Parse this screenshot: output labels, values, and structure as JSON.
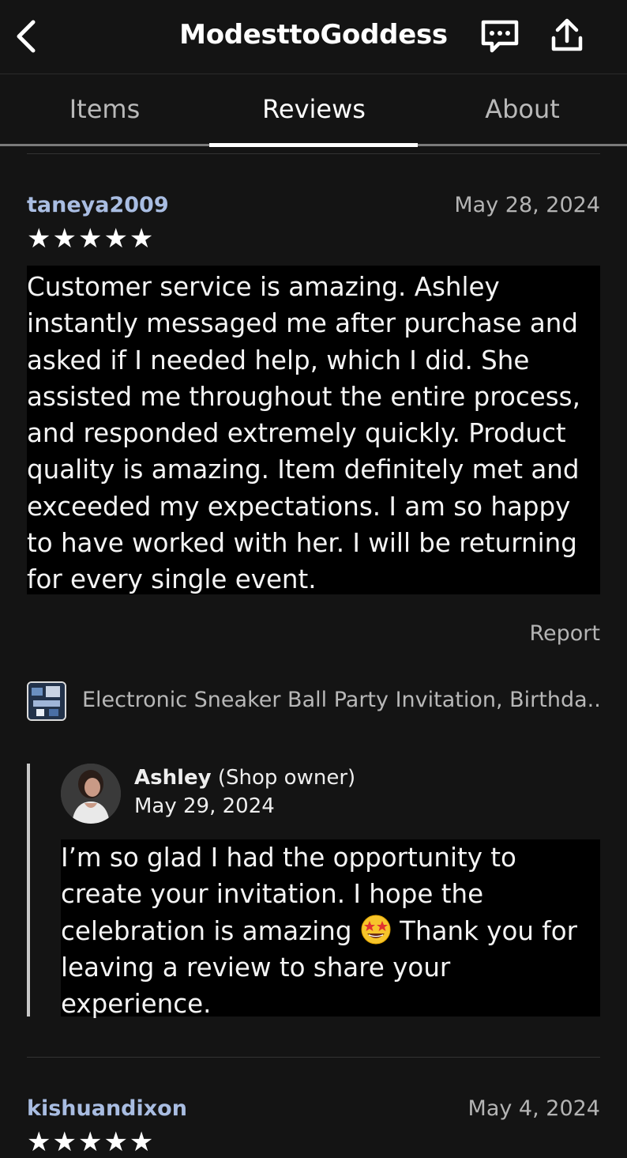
{
  "header": {
    "title": "ModesttoGoddess",
    "back_icon": "chevron-left-icon",
    "message_icon": "message-icon",
    "share_icon": "share-icon"
  },
  "tabs": [
    {
      "label": "Items",
      "active": false
    },
    {
      "label": "Reviews",
      "active": true
    },
    {
      "label": "About",
      "active": false
    }
  ],
  "reviews": [
    {
      "reviewer": "taneya2009",
      "date": "May 28, 2024",
      "stars": "★★★★★",
      "rating": 5,
      "text": "Customer service is amazing. Ashley instantly messaged me after purchase and asked if I needed help, which I did. She assisted me throughout the entire process, and responded extremely quickly. Product quality is amazing. Item definitely met and exceeded my expectations. I am so happy to have worked with her. I will be returning for every single event.",
      "report_label": "Report",
      "product_title": "Electronic Sneaker Ball Party Invitation, Birthda...",
      "reply": {
        "owner_name": "Ashley",
        "owner_role": "(Shop owner)",
        "date": "May 29, 2024",
        "text_before_emoji": "I’m so glad I had the opportunity to create your invitation. I hope the celebration is amazing ",
        "emoji": "star-struck-emoji",
        "text_after_emoji": " Thank you for leaving a review to share your experience."
      }
    },
    {
      "reviewer": "kishuandixon",
      "date": "May 4, 2024",
      "stars": "★★★★★",
      "rating": 5
    }
  ],
  "colors": {
    "background": "#141414",
    "reviewer_name": "#a9bde2",
    "text_highlight_bg": "#000000"
  }
}
